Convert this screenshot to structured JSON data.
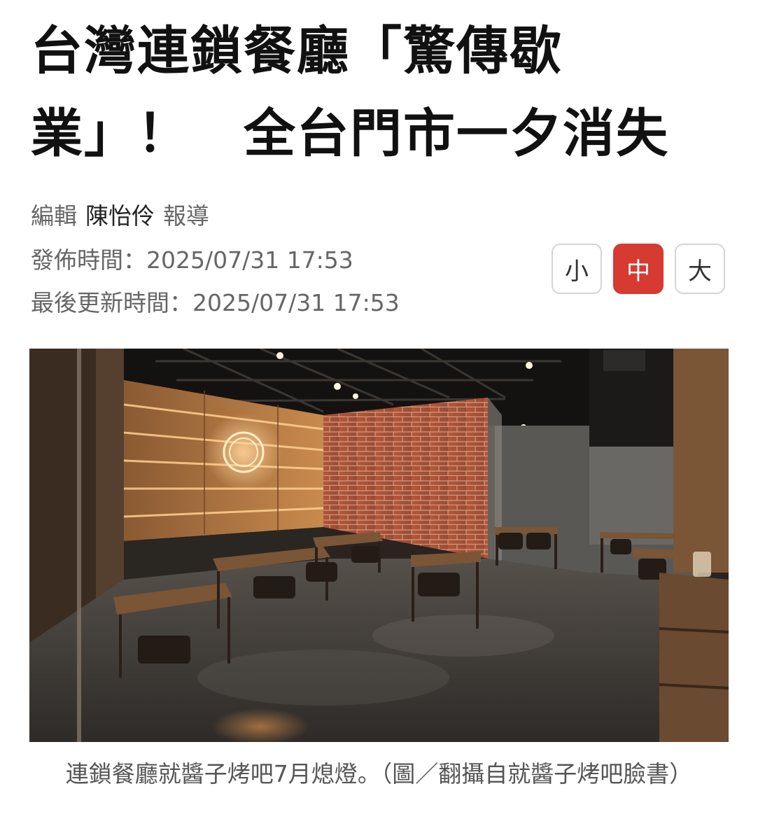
{
  "article": {
    "headline_line1": "台灣連鎖餐廳「驚傳歇",
    "headline_line2": "業」！　全台門市一夕消失",
    "byline_prefix": "編輯",
    "author": "陳怡伶",
    "byline_suffix": "報導",
    "published_label": "發佈時間：",
    "published_time": "2025/07/31 17:53",
    "updated_label": "最後更新時間：",
    "updated_time": "2025/07/31 17:53"
  },
  "font_size": {
    "small": "小",
    "medium": "中",
    "large": "大",
    "selected": "中"
  },
  "photo": {
    "caption": "連鎖餐廳就醬子烤吧7月熄燈。（圖／翻攝自就醬子烤吧臉書）"
  },
  "colors": {
    "accent": "#d63a30",
    "meta_text": "#666666",
    "caption_text": "#555555"
  }
}
